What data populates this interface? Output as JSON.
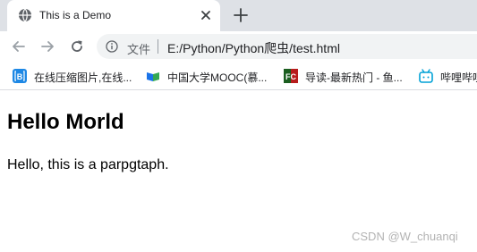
{
  "tab": {
    "title": "This is a Demo"
  },
  "address_bar": {
    "file_label": "文件",
    "url": "E:/Python/Python爬虫/test.html"
  },
  "bookmarks": [
    {
      "label": "在线压缩图片,在线...",
      "icon": "bracket-b-icon"
    },
    {
      "label": "中国大学MOOC(慕...",
      "icon": "mooc-book-icon"
    },
    {
      "label": "导读-最新热门 - 鱼...",
      "icon": "fc-icon"
    },
    {
      "label": "哔哩哔哩",
      "icon": "bilibili-tv-icon"
    }
  ],
  "page": {
    "heading": "Hello Morld",
    "paragraph": "Hello, this is a parpgtaph."
  },
  "watermark": "CSDN @W_chuanqi",
  "colors": {
    "tabstrip": "#dee1e6",
    "omnibox": "#f1f3f4",
    "icon": "#5f6368"
  }
}
